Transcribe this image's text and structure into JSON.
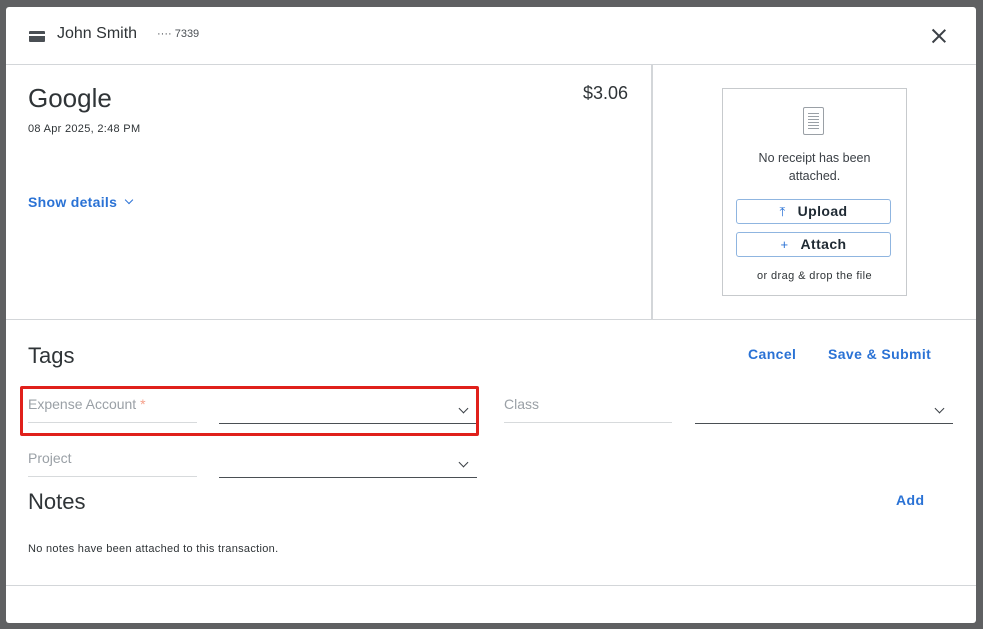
{
  "header": {
    "cardholder": "John Smith",
    "card_mask": "···· 7339",
    "card_icon": "credit-card-icon",
    "close_icon": "close-icon"
  },
  "transaction": {
    "merchant": "Google",
    "datetime": "08 Apr 2025, 2:48 PM",
    "amount": "$3.06",
    "show_details_label": "Show details"
  },
  "receipt": {
    "icon": "receipt-icon",
    "message": "No receipt has been attached.",
    "upload_label": "Upload",
    "upload_icon": "⤒",
    "attach_label": "Attach",
    "attach_icon": "+",
    "drag_text": "or drag & drop the file"
  },
  "tags": {
    "title": "Tags",
    "cancel_label": "Cancel",
    "save_label": "Save & Submit",
    "fields": {
      "expense_account": {
        "label": "Expense Account",
        "required_mark": "*",
        "value": ""
      },
      "class": {
        "label": "Class",
        "value": ""
      },
      "project": {
        "label": "Project",
        "value": ""
      }
    }
  },
  "notes": {
    "title": "Notes",
    "add_label": "Add",
    "empty_message": "No notes have been attached to this transaction."
  },
  "colors": {
    "accent": "#2a72d5",
    "highlight": "#e0201b",
    "required": "#f5a08a",
    "overlay": "#5f6062"
  }
}
